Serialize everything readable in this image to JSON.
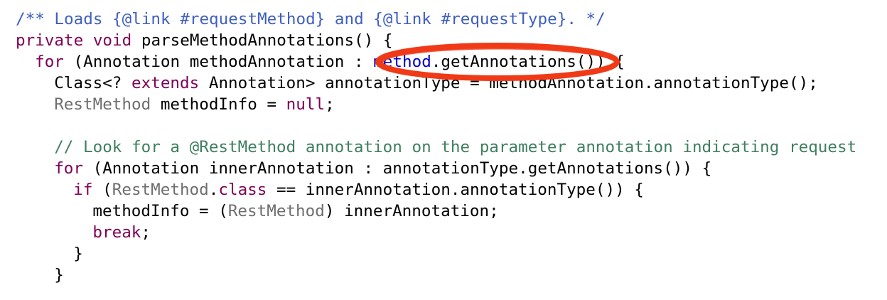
{
  "code": {
    "lines": [
      {
        "indent": 0,
        "tokens": [
          {
            "kind": "doc",
            "text": "/** Loads {@link #requestMethod} and {@link #requestType}. */"
          }
        ]
      },
      {
        "indent": 0,
        "tokens": [
          {
            "kind": "kw",
            "text": "private"
          },
          {
            "kind": "plain",
            "text": " "
          },
          {
            "kind": "kw",
            "text": "void"
          },
          {
            "kind": "plain",
            "text": " parseMethodAnnotations() {"
          }
        ]
      },
      {
        "indent": 2,
        "tokens": [
          {
            "kind": "kw",
            "text": "for"
          },
          {
            "kind": "plain",
            "text": " (Annotation methodAnnotation : "
          },
          {
            "kind": "field",
            "text": "method"
          },
          {
            "kind": "plain",
            "text": ".getAnnotations()) {"
          }
        ]
      },
      {
        "indent": 4,
        "tokens": [
          {
            "kind": "plain",
            "text": "Class<? "
          },
          {
            "kind": "kw",
            "text": "extends"
          },
          {
            "kind": "plain",
            "text": " Annotation> annotationType = methodAnnotation.annotationType();"
          }
        ]
      },
      {
        "indent": 4,
        "tokens": [
          {
            "kind": "type",
            "text": "RestMethod"
          },
          {
            "kind": "plain",
            "text": " methodInfo = "
          },
          {
            "kind": "kw",
            "text": "null"
          },
          {
            "kind": "plain",
            "text": ";"
          }
        ]
      },
      {
        "indent": 0,
        "tokens": []
      },
      {
        "indent": 4,
        "tokens": [
          {
            "kind": "comment",
            "text": "// Look for a @RestMethod annotation on the parameter annotation indicating request"
          }
        ]
      },
      {
        "indent": 4,
        "tokens": [
          {
            "kind": "kw",
            "text": "for"
          },
          {
            "kind": "plain",
            "text": " (Annotation innerAnnotation : annotationType.getAnnotations()) {"
          }
        ]
      },
      {
        "indent": 6,
        "tokens": [
          {
            "kind": "kw",
            "text": "if"
          },
          {
            "kind": "plain",
            "text": " ("
          },
          {
            "kind": "type",
            "text": "RestMethod"
          },
          {
            "kind": "plain",
            "text": "."
          },
          {
            "kind": "kw",
            "text": "class"
          },
          {
            "kind": "plain",
            "text": " == innerAnnotation.annotationType()) {"
          }
        ]
      },
      {
        "indent": 8,
        "tokens": [
          {
            "kind": "plain",
            "text": "methodInfo = ("
          },
          {
            "kind": "type",
            "text": "RestMethod"
          },
          {
            "kind": "plain",
            "text": ") innerAnnotation;"
          }
        ]
      },
      {
        "indent": 8,
        "tokens": [
          {
            "kind": "kw",
            "text": "break"
          },
          {
            "kind": "plain",
            "text": ";"
          }
        ]
      },
      {
        "indent": 6,
        "tokens": [
          {
            "kind": "plain",
            "text": "}"
          }
        ]
      },
      {
        "indent": 4,
        "tokens": [
          {
            "kind": "plain",
            "text": "}"
          }
        ]
      }
    ]
  },
  "highlight": {
    "label": "red-ellipse-around-method-getAnnotations",
    "color": "#f03a17"
  },
  "colors": {
    "doc": "#3f5fbf",
    "keyword": "#7f0055",
    "comment": "#3f7f5f",
    "field": "#0000c0",
    "type": "#6e6e6e",
    "plain": "#000000",
    "background": "#ffffff"
  }
}
